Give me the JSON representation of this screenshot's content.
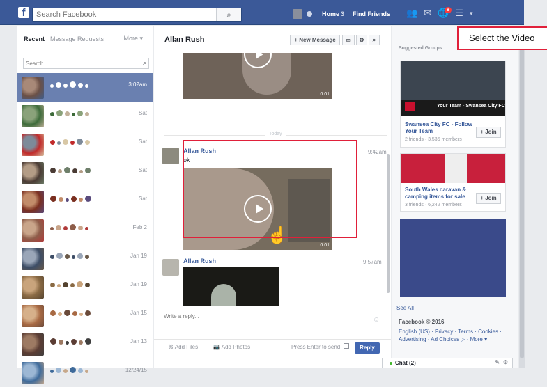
{
  "topbar": {
    "logo": "f",
    "search_placeholder": "Search Facebook",
    "nav_home": "Home",
    "nav_home_count": "3",
    "nav_find_friends": "Find Friends",
    "notif_count": "8",
    "brand_color": "#3b5998"
  },
  "left": {
    "tab_recent": "Recent",
    "tab_requests": "Message Requests",
    "tab_more": "More ▾",
    "search_placeholder": "Search",
    "conversations": [
      {
        "date": "3:02am"
      },
      {
        "date": "Sat"
      },
      {
        "date": "Sat"
      },
      {
        "date": "Sat"
      },
      {
        "date": "Sat"
      },
      {
        "date": "Feb 2"
      },
      {
        "date": "Jan 19"
      },
      {
        "date": "Jan 19"
      },
      {
        "date": "Jan 15"
      },
      {
        "date": "Jan 13"
      },
      {
        "date": "12/24/15"
      }
    ]
  },
  "thread": {
    "title": "Allan Rush",
    "new_message": "+ New Message",
    "divider_label": "Today",
    "messages": [
      {
        "sender": "Allan Rush",
        "text": "ok",
        "time": "9:42am",
        "video_duration": "0:01"
      },
      {
        "sender": "Allan Rush",
        "time": "9:57am"
      }
    ],
    "first_video_duration": "0:01",
    "reply_placeholder": "Write a reply...",
    "add_files": "Add Files",
    "add_photos": "Add Photos",
    "press_enter": "Press Enter to send",
    "reply_button": "Reply"
  },
  "right": {
    "suggested_title": "Suggested Groups",
    "groups": [
      {
        "name": "Swansea City FC - Follow Your Team",
        "meta": "2 friends · 3,535 members",
        "join": "+ Join",
        "banner": "Your Team - Swansea City FC"
      },
      {
        "name": "South Wales caravan & camping items for sale",
        "meta": "3 friends · 6,242 members",
        "join": "+ Join"
      }
    ],
    "see_all": "See All",
    "copyright": "Facebook © 2016",
    "footer_links": "English (US) · Privacy · Terms · Cookies · Advertising · Ad Choices ▷ · More ▾"
  },
  "chat": {
    "label": "Chat (2)"
  },
  "annotation": {
    "callout": "Select the Video",
    "accent": "#e0203a"
  }
}
